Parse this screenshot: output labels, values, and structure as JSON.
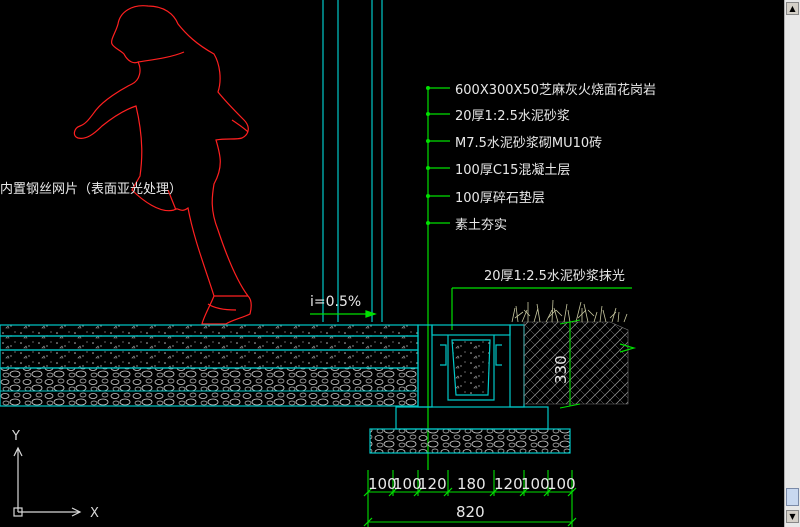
{
  "callout": {
    "layers": [
      "600X300X50芝麻灰火烧面花岗岩",
      "20厚1:2.5水泥砂浆",
      "M7.5水泥砂浆砌MU10砖",
      "100厚C15混凝土层",
      "100厚碎石垫层",
      "素土夯实"
    ],
    "finish": "20厚1:2.5水泥砂浆抹光",
    "left_note": "内置钢丝网片（表面亚光处理）"
  },
  "slope": "i=0.5%",
  "dimensions": {
    "segments": [
      "100",
      "100",
      "120",
      "180",
      "120",
      "100",
      "100"
    ],
    "total": "820",
    "height": "330"
  },
  "ucs": {
    "x_label": "X",
    "y_label": "Y"
  },
  "colors": {
    "background": "#000000",
    "structure": "#00c8c8",
    "leader": "#00e000",
    "figure": "#ff2020",
    "grass": "#c8c8a0",
    "text": "#e8e8e8"
  }
}
